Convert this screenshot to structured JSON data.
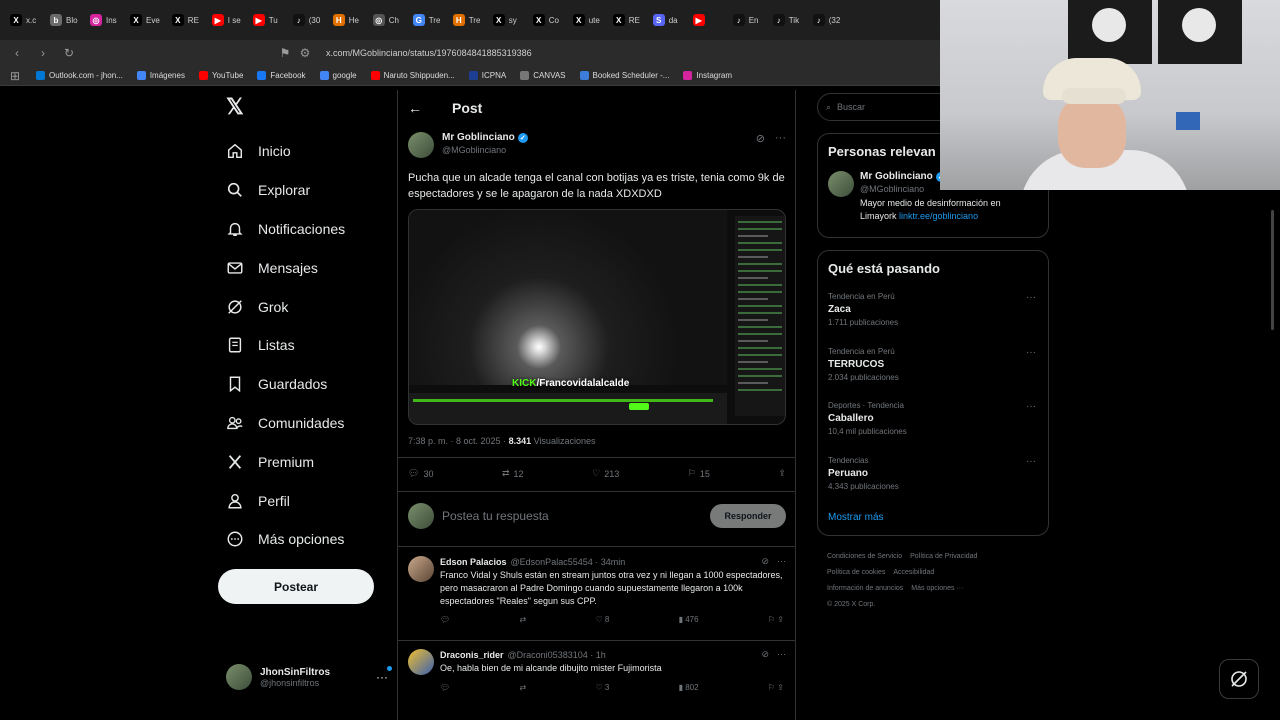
{
  "browser": {
    "tabs": [
      {
        "label": "x.c",
        "icon": "X",
        "color": "#000000"
      },
      {
        "label": "Blo",
        "icon": "b",
        "color": "#6b6b6b"
      },
      {
        "label": "Ins",
        "icon": "◎",
        "color": "#d6249f"
      },
      {
        "label": "Eve",
        "icon": "X",
        "color": "#000000"
      },
      {
        "label": "RE",
        "icon": "X",
        "color": "#000000"
      },
      {
        "label": "I se",
        "icon": "▶",
        "color": "#ff0000"
      },
      {
        "label": "Tu",
        "icon": "▶",
        "color": "#ff0000"
      },
      {
        "label": "(30",
        "icon": "♪",
        "color": "#111111"
      },
      {
        "label": "He",
        "icon": "H",
        "color": "#e07000"
      },
      {
        "label": "Ch",
        "icon": "◎",
        "color": "#555555"
      },
      {
        "label": "Tre",
        "icon": "G",
        "color": "#4285f4"
      },
      {
        "label": "Tre",
        "icon": "H",
        "color": "#e07000"
      },
      {
        "label": "sy",
        "icon": "X",
        "color": "#000000"
      },
      {
        "label": "Co",
        "icon": "X",
        "color": "#000000"
      },
      {
        "label": "ute",
        "icon": "X",
        "color": "#000000"
      },
      {
        "label": "RE",
        "icon": "X",
        "color": "#000000"
      },
      {
        "label": "da",
        "icon": "S",
        "color": "#5865f2"
      },
      {
        "label": "",
        "icon": "▶",
        "color": "#ff0000"
      },
      {
        "label": "En",
        "icon": "♪",
        "color": "#111111"
      },
      {
        "label": "Tik",
        "icon": "♪",
        "color": "#111111"
      },
      {
        "label": "(32",
        "icon": "♪",
        "color": "#111111"
      }
    ],
    "url": "x.com/MGoblinciano/status/1976084841885319386",
    "bookmarks": [
      {
        "label": "Outlook.com - jhon...",
        "color": "#0078d4"
      },
      {
        "label": "Imágenes",
        "color": "#4285f4"
      },
      {
        "label": "YouTube",
        "color": "#ff0000"
      },
      {
        "label": "Facebook",
        "color": "#1877f2"
      },
      {
        "label": "google",
        "color": "#4285f4"
      },
      {
        "label": "Naruto Shippuden...",
        "color": "#ff0000"
      },
      {
        "label": "ICPNA",
        "color": "#1c3f94"
      },
      {
        "label": "CANVAS",
        "color": "#777777"
      },
      {
        "label": "Booked Scheduler -...",
        "color": "#3b7dd8"
      },
      {
        "label": "Instagram",
        "color": "#d6249f"
      }
    ]
  },
  "nav": {
    "items": [
      {
        "label": "Inicio",
        "icon": "home-icon"
      },
      {
        "label": "Explorar",
        "icon": "search-icon"
      },
      {
        "label": "Notificaciones",
        "icon": "bell-icon"
      },
      {
        "label": "Mensajes",
        "icon": "mail-icon"
      },
      {
        "label": "Grok",
        "icon": "grok-icon"
      },
      {
        "label": "Listas",
        "icon": "list-icon"
      },
      {
        "label": "Guardados",
        "icon": "bookmark-icon"
      },
      {
        "label": "Comunidades",
        "icon": "people-icon"
      },
      {
        "label": "Premium",
        "icon": "x-logo-icon"
      },
      {
        "label": "Perfil",
        "icon": "person-icon"
      },
      {
        "label": "Más opciones",
        "icon": "more-circle-icon"
      }
    ],
    "post_button": "Postear",
    "account": {
      "name": "JhonSinFiltros",
      "handle": "@jhonsinfiltros"
    }
  },
  "post": {
    "header": "Post",
    "author": {
      "name": "Mr Goblinciano",
      "handle": "@MGoblinciano"
    },
    "text": "Pucha que un alcade tenga el canal con botijas ya es triste, tenia como 9k de espectadores y se le apagaron de la nada XDXDXD",
    "media_caption": "KICK",
    "media_caption_path": "/Francovidalalcalde",
    "time": "7:38 p. m. · 8 oct. 2025 · ",
    "views": "8.341",
    "views_label": " Visualizaciones",
    "stats": {
      "replies": "30",
      "reposts": "12",
      "likes": "213",
      "bookmarks": "15"
    },
    "reply_placeholder": "Postea tu respuesta",
    "reply_button": "Responder"
  },
  "replies": [
    {
      "name": "Edson Palacios",
      "handle": "@EdsonPalac55454 · 34min",
      "text": "Franco Vidal y Shuls están en stream juntos otra vez y ni llegan a 1000 espectadores, pero masacraron al Padre Domingo cuando supuestamente llegaron a 100k espectadores \"Reales\" segun sus CPP.",
      "likes": "8",
      "views": "476"
    },
    {
      "name": "Draconis_rider",
      "handle": "@Draconi05383104 · 1h",
      "text": "Oe, habla bien de mi alcande dibujito mister Fujimorista",
      "likes": "3",
      "views": "802"
    }
  ],
  "sidebar": {
    "search_placeholder": "Buscar",
    "relevant_title": "Personas relevan",
    "relevant": {
      "name": "Mr Goblinciano",
      "handle": "@MGoblinciano",
      "bio": "Mayor medio de desinformación en Limayork ",
      "link": "linktr.ee/goblinciano"
    },
    "trends_title": "Qué está pasando",
    "trends": [
      {
        "context": "Tendencia en Perú",
        "name": "Zaca",
        "count": "1.711 publicaciones"
      },
      {
        "context": "Tendencia en Perú",
        "name": "TERRUCOS",
        "count": "2.034 publicaciones"
      },
      {
        "context": "Deportes · Tendencia",
        "name": "Caballero",
        "count": "10,4 mil publicaciones"
      },
      {
        "context": "Tendencias",
        "name": "Peruano",
        "count": "4.343 publicaciones"
      }
    ],
    "show_more": "Mostrar más",
    "footer": [
      "Condiciones de Servicio",
      "Política de Privacidad",
      "Política de cookies",
      "Accesibilidad",
      "Información de anuncios",
      "Más opciones ···",
      "© 2025 X Corp."
    ]
  },
  "colors": {
    "accent": "#1d9bf0",
    "background": "#000000",
    "border": "#2f3336",
    "muted": "#71767b",
    "kick_green": "#53fc18"
  }
}
